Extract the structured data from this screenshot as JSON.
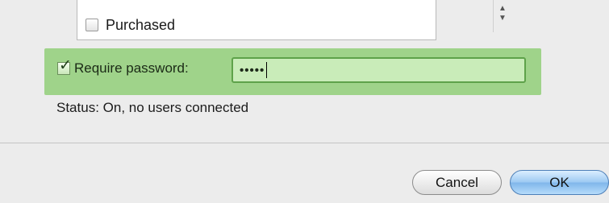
{
  "list": {
    "item_label": "Purchased",
    "item_checked": false,
    "stepper": {
      "up_icon": "▲",
      "down_icon": "▼"
    }
  },
  "password": {
    "require_label": "Require password:",
    "require_checked": true,
    "check_glyph": "✓",
    "value": "•••••"
  },
  "status": {
    "text": "Status: On, no users connected"
  },
  "buttons": {
    "cancel_label": "Cancel",
    "ok_label": "OK"
  },
  "colors": {
    "highlight": "#9fd38a",
    "ok_button": "#7fb6ea"
  }
}
